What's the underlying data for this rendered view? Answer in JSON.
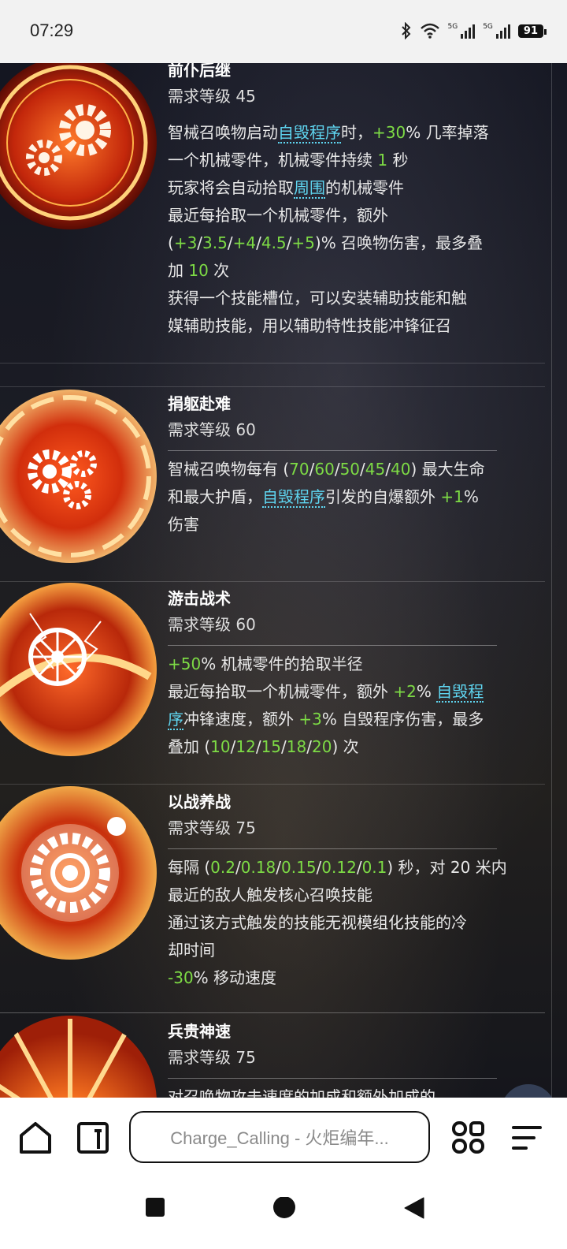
{
  "status_bar": {
    "time": "07:29",
    "icons": [
      "bluetooth-icon",
      "wifi-icon",
      "signal-5g-icon",
      "signal-5g-icon",
      "battery-icon"
    ],
    "signal_label": "5G",
    "battery": "91"
  },
  "cards": [
    {
      "title": "前仆后继",
      "level": "需求等级 45",
      "lines": [
        [
          {
            "t": "智械召唤物启动"
          },
          {
            "t": "自毁程序",
            "c": "k"
          },
          {
            "t": "时，"
          },
          {
            "t": "+30",
            "c": "g"
          },
          {
            "t": "% 几率掉落"
          }
        ],
        [
          {
            "t": "一个机械零件，机械零件持续 "
          },
          {
            "t": "1",
            "c": "g"
          },
          {
            "t": " 秒"
          }
        ],
        [
          {
            "t": "玩家将会自动拾取"
          },
          {
            "t": "周围",
            "c": "k"
          },
          {
            "t": "的机械零件"
          }
        ],
        [
          {
            "t": "最近每拾取一个机械零件，额外"
          }
        ],
        [
          {
            "t": "("
          },
          {
            "t": "+3",
            "c": "g"
          },
          {
            "t": "/"
          },
          {
            "t": "3.5",
            "c": "g"
          },
          {
            "t": "/"
          },
          {
            "t": "+4",
            "c": "g"
          },
          {
            "t": "/"
          },
          {
            "t": "4.5",
            "c": "g"
          },
          {
            "t": "/"
          },
          {
            "t": "+5",
            "c": "g"
          },
          {
            "t": ")% 召唤物伤害，最多叠"
          }
        ],
        [
          {
            "t": "加 "
          },
          {
            "t": "10",
            "c": "g"
          },
          {
            "t": " 次"
          }
        ],
        [
          {
            "t": "获得一个技能槽位，可以安装辅助技能和触"
          }
        ],
        [
          {
            "t": "媒辅助技能，用以辅助特性技能冲锋征召"
          }
        ]
      ]
    },
    {
      "title": "捐躯赴难",
      "level": "需求等级 60",
      "lines": [
        [
          {
            "t": "智械召唤物每有 ("
          },
          {
            "t": "70",
            "c": "g"
          },
          {
            "t": "/"
          },
          {
            "t": "60",
            "c": "g"
          },
          {
            "t": "/"
          },
          {
            "t": "50",
            "c": "g"
          },
          {
            "t": "/"
          },
          {
            "t": "45",
            "c": "g"
          },
          {
            "t": "/"
          },
          {
            "t": "40",
            "c": "g"
          },
          {
            "t": ") 最大生命"
          }
        ],
        [
          {
            "t": "和最大护盾，"
          },
          {
            "t": "自毁程序",
            "c": "k"
          },
          {
            "t": "引发的自爆额外 "
          },
          {
            "t": "+1",
            "c": "g"
          },
          {
            "t": "%"
          }
        ],
        [
          {
            "t": "伤害"
          }
        ]
      ]
    },
    {
      "title": "游击战术",
      "level": "需求等级 60",
      "lines": [
        [
          {
            "t": "+50",
            "c": "g"
          },
          {
            "t": "% 机械零件的拾取半径"
          }
        ],
        [
          {
            "t": "最近每拾取一个机械零件，额外 "
          },
          {
            "t": "+2",
            "c": "g"
          },
          {
            "t": "% "
          },
          {
            "t": "自毁程",
            "c": "k"
          }
        ],
        [
          {
            "t": "序",
            "c": "k"
          },
          {
            "t": "冲锋速度，额外 "
          },
          {
            "t": "+3",
            "c": "g"
          },
          {
            "t": "% 自毁程序伤害，最多"
          }
        ],
        [
          {
            "t": "叠加 ("
          },
          {
            "t": "10",
            "c": "g"
          },
          {
            "t": "/"
          },
          {
            "t": "12",
            "c": "g"
          },
          {
            "t": "/"
          },
          {
            "t": "15",
            "c": "g"
          },
          {
            "t": "/"
          },
          {
            "t": "18",
            "c": "g"
          },
          {
            "t": "/"
          },
          {
            "t": "20",
            "c": "g"
          },
          {
            "t": ") 次"
          }
        ]
      ]
    },
    {
      "title": "以战养战",
      "level": "需求等级 75",
      "lines": [
        [
          {
            "t": "每隔 ("
          },
          {
            "t": "0.2",
            "c": "g"
          },
          {
            "t": "/"
          },
          {
            "t": "0.18",
            "c": "g"
          },
          {
            "t": "/"
          },
          {
            "t": "0.15",
            "c": "g"
          },
          {
            "t": "/"
          },
          {
            "t": "0.12",
            "c": "g"
          },
          {
            "t": "/"
          },
          {
            "t": "0.1",
            "c": "g"
          },
          {
            "t": ") 秒，对 20 米内"
          }
        ],
        [
          {
            "t": "最近的敌人触发核心召唤技能"
          }
        ],
        [
          {
            "t": "通过该方式触发的技能无视模组化技能的冷"
          }
        ],
        [
          {
            "t": "却时间"
          }
        ],
        [
          {
            "t": "-30",
            "c": "g"
          },
          {
            "t": "% 移动速度"
          }
        ]
      ]
    },
    {
      "title": "兵贵神速",
      "level": "需求等级 75",
      "lines": [
        [
          {
            "t": "对召唤物攻击速度的加成和额外加成的"
          }
        ]
      ]
    }
  ],
  "bottom_bar": {
    "home_icon": "home-icon",
    "tabs_icon": "tabs-icon",
    "url_text": "Charge_Calling - 火炬编年...",
    "apps_icon": "grid-icon",
    "menu_icon": "menu-icon"
  },
  "system_nav": [
    "recents-square-icon",
    "home-circle-icon",
    "back-triangle-icon"
  ],
  "colors": {
    "highlight_green": "#7ddb45",
    "keyword_cyan": "#5fd6f1",
    "background": "#1b1c24"
  }
}
